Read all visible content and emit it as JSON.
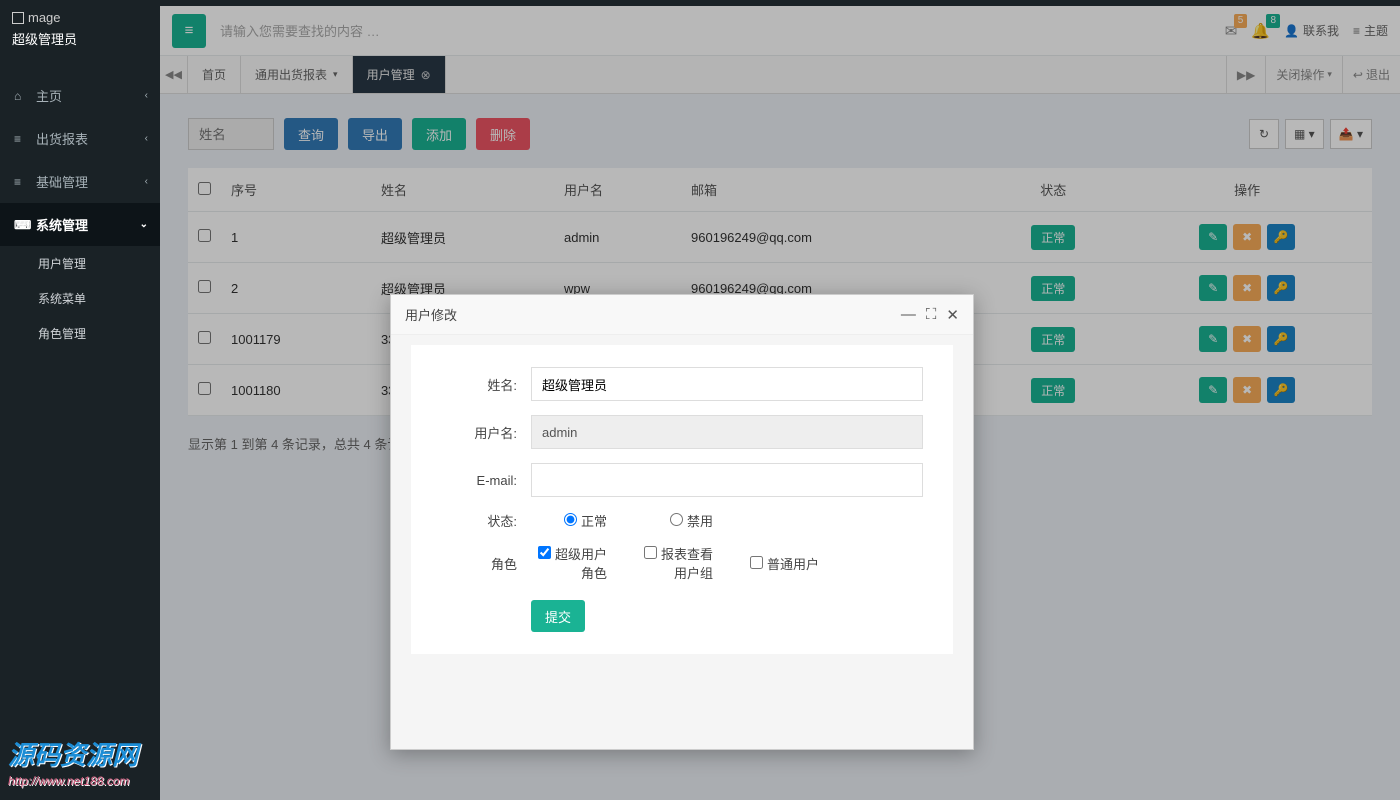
{
  "brand": {
    "logo_text": "mage",
    "role": "超级管理员"
  },
  "sidebar": {
    "items": [
      {
        "label": "主页",
        "icon": "home"
      },
      {
        "label": "出货报表",
        "icon": "list"
      },
      {
        "label": "基础管理",
        "icon": "list"
      },
      {
        "label": "系统管理",
        "icon": "monitor"
      }
    ],
    "submenu": [
      {
        "label": "用户管理"
      },
      {
        "label": "系统菜单"
      },
      {
        "label": "角色管理"
      }
    ]
  },
  "header": {
    "search_placeholder": "请输入您需要查找的内容 …",
    "badge_mail": "5",
    "badge_bell": "8",
    "contact": "联系我",
    "theme": "主题"
  },
  "tabs": {
    "home": "首页",
    "report": "通用出货报表",
    "users": "用户管理",
    "close_ops": "关闭操作",
    "logout": "退出"
  },
  "toolbar": {
    "name_placeholder": "姓名",
    "query": "查询",
    "export": "导出",
    "add": "添加",
    "delete": "删除"
  },
  "table": {
    "columns": {
      "seq": "序号",
      "name": "姓名",
      "username": "用户名",
      "email": "邮箱",
      "status": "状态",
      "ops": "操作"
    },
    "rows": [
      {
        "seq": "1",
        "name": "超级管理员",
        "username": "admin",
        "email": "960196249@qq.com",
        "status": "正常"
      },
      {
        "seq": "2",
        "name": "超级管理员",
        "username": "wpw",
        "email": "960196249@qq.com",
        "status": "正常"
      },
      {
        "seq": "1001179",
        "name": "3379",
        "username": "",
        "email": "",
        "status": "正常"
      },
      {
        "seq": "1001180",
        "name": "3378",
        "username": "",
        "email": "",
        "status": "正常"
      }
    ],
    "footer": "显示第 1 到第 4 条记录，总共 4 条记录"
  },
  "dialog": {
    "title": "用户修改",
    "labels": {
      "name": "姓名:",
      "username": "用户名:",
      "email": "E-mail:",
      "status": "状态:",
      "role": "角色"
    },
    "values": {
      "name": "超级管理员",
      "username": "admin",
      "email": ""
    },
    "status_opts": {
      "normal": "正常",
      "disabled": "禁用"
    },
    "role_opts": {
      "super": "超级用户角色",
      "report": "报表查看用户组",
      "normal": "普通用户"
    },
    "submit": "提交"
  },
  "watermark": {
    "main": "源码资源网",
    "sub": "http://www.net188.com"
  }
}
